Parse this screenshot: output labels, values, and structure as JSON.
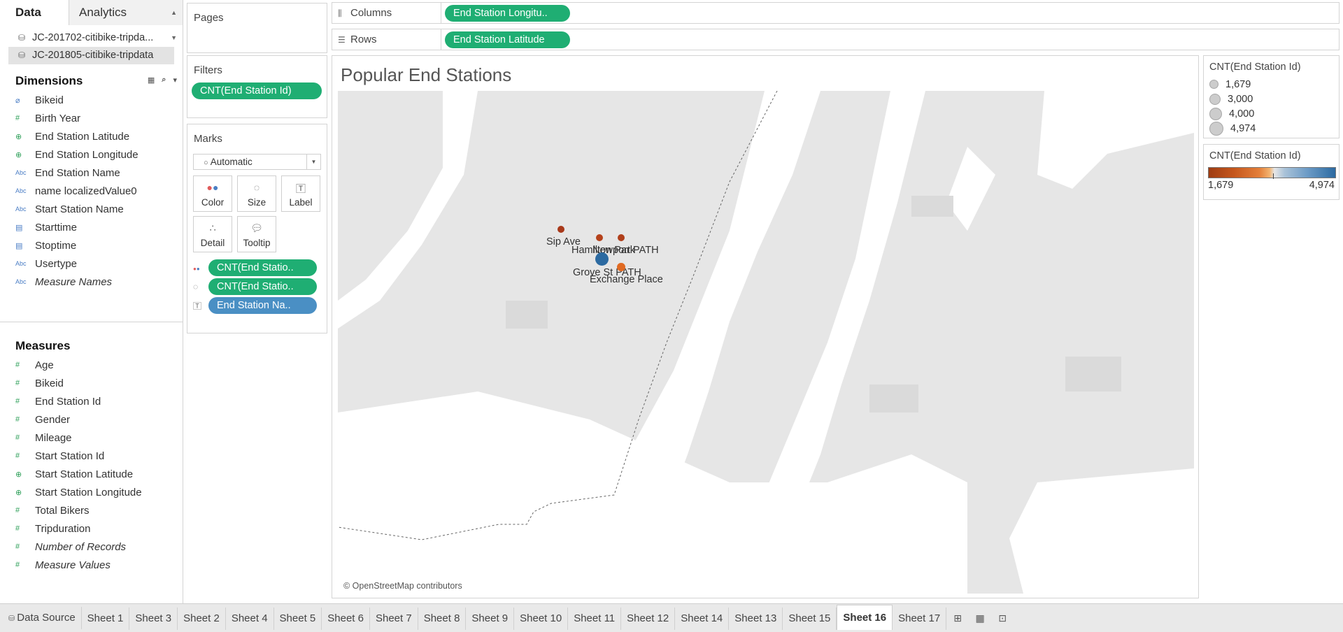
{
  "left_pane": {
    "tabs": [
      "Data",
      "Analytics"
    ],
    "datasources": [
      "JC-201702-citibike-tripda...",
      "JC-201805-citibike-tripdata"
    ],
    "dimensions_label": "Dimensions",
    "dimensions": [
      {
        "type": "clip",
        "name": "Bikeid"
      },
      {
        "type": "num",
        "name": "Birth Year"
      },
      {
        "type": "geo",
        "name": "End Station Latitude"
      },
      {
        "type": "geo",
        "name": "End Station Longitude"
      },
      {
        "type": "abc",
        "name": "End Station Name"
      },
      {
        "type": "abc",
        "name": "name localizedValue0"
      },
      {
        "type": "abc",
        "name": "Start Station Name"
      },
      {
        "type": "cal",
        "name": "Starttime"
      },
      {
        "type": "cal",
        "name": "Stoptime"
      },
      {
        "type": "abc",
        "name": "Usertype"
      },
      {
        "type": "abc",
        "name": "Measure Names",
        "italic": true
      }
    ],
    "measures_label": "Measures",
    "measures": [
      {
        "type": "num",
        "name": "Age"
      },
      {
        "type": "num",
        "name": "Bikeid"
      },
      {
        "type": "num",
        "name": "End Station Id"
      },
      {
        "type": "num",
        "name": "Gender"
      },
      {
        "type": "num",
        "name": "Mileage"
      },
      {
        "type": "num",
        "name": "Start Station Id"
      },
      {
        "type": "geo",
        "name": "Start Station Latitude"
      },
      {
        "type": "geo",
        "name": "Start Station Longitude"
      },
      {
        "type": "num",
        "name": "Total Bikers"
      },
      {
        "type": "num",
        "name": "Tripduration"
      },
      {
        "type": "num",
        "name": "Number of Records",
        "italic": true
      },
      {
        "type": "num",
        "name": "Measure Values",
        "italic": true
      }
    ]
  },
  "pages": {
    "title": "Pages"
  },
  "filters": {
    "title": "Filters",
    "pill": "CNT(End Station Id)"
  },
  "marks": {
    "title": "Marks",
    "type": "Automatic",
    "buttons": {
      "color": "Color",
      "size": "Size",
      "label": "Label",
      "detail": "Detail",
      "tooltip": "Tooltip"
    },
    "encodings": [
      "CNT(End Statio..",
      "CNT(End Statio..",
      "End Station Na.."
    ]
  },
  "columns": {
    "label": "Columns",
    "pill": "End Station Longitu.."
  },
  "rows": {
    "label": "Rows",
    "pill": "End Station Latitude"
  },
  "view": {
    "title": "Popular End Stations",
    "attribution": "© OpenStreetMap contributors",
    "stations": [
      {
        "name": "Sip Ave",
        "count": 2100,
        "color": "#a8391a"
      },
      {
        "name": "Hamilton Park",
        "count": 2300,
        "color": "#b5421b"
      },
      {
        "name": "Newport PATH",
        "count": 2200,
        "color": "#b03f1b"
      },
      {
        "name": "Grove St PATH",
        "count": 4974,
        "color": "#2c6aa1"
      },
      {
        "name": "Exchange Place",
        "count": 2600,
        "color": "#e06a22"
      }
    ]
  },
  "size_legend": {
    "title": "CNT(End Station Id)",
    "items": [
      "1,679",
      "3,000",
      "4,000",
      "4,974"
    ]
  },
  "color_legend": {
    "title": "CNT(End Station Id)",
    "min": "1,679",
    "max": "4,974",
    "colors": {
      "low": "#9e3d13",
      "mid": "#e6e6e6",
      "high": "#2c6aa1"
    }
  },
  "tabs": {
    "data_source": "Data Source",
    "sheets": [
      "Sheet 1",
      "Sheet 3",
      "Sheet 2",
      "Sheet 4",
      "Sheet 5",
      "Sheet 6",
      "Sheet 7",
      "Sheet 8",
      "Sheet 9",
      "Sheet 10",
      "Sheet 11",
      "Sheet 12",
      "Sheet 14",
      "Sheet 13",
      "Sheet 15",
      "Sheet 16",
      "Sheet 17"
    ],
    "active": "Sheet 16",
    "action_icons": [
      "new-worksheet-icon",
      "new-dashboard-icon",
      "new-story-icon"
    ]
  }
}
